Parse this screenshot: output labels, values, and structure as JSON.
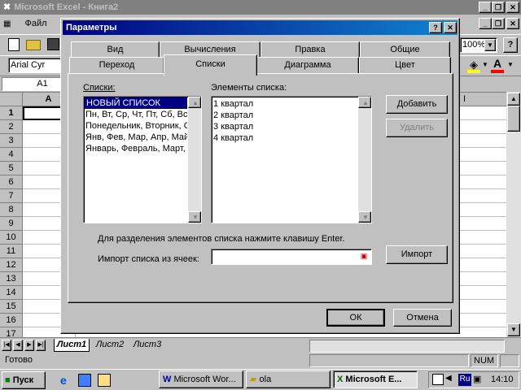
{
  "excel": {
    "title": "Microsoft Excel - Книга2",
    "menu": [
      "Файл"
    ],
    "zoom": "100%",
    "font_name": "Arial Cyr",
    "cell_ref": "A1",
    "column_a": "A",
    "column_i": "I",
    "rows": [
      "1",
      "2",
      "3",
      "4",
      "5",
      "6",
      "7",
      "8",
      "9",
      "10",
      "11",
      "12",
      "13",
      "14",
      "15",
      "16",
      "17"
    ],
    "sheets": [
      "Лист1",
      "Лист2",
      "Лист3"
    ],
    "status": "Готово",
    "num": "NUM"
  },
  "dialog": {
    "title": "Параметры",
    "help_btn": "?",
    "close_btn": "✕",
    "tabs_back": [
      "Вид",
      "Вычисления",
      "Правка",
      "Общие"
    ],
    "tabs_front": [
      "Переход",
      "Списки",
      "Диаграмма",
      "Цвет"
    ],
    "lists_label": "Списки:",
    "lists": [
      "НОВЫЙ СПИСОК",
      "Пн, Вт, Ср, Чт, Пт, Сб, Вс",
      "Понедельник, Вторник, Среда",
      "Янв, Фев, Мар, Апр, Май, Июн",
      "Январь, Февраль, Март, Апрель"
    ],
    "entries_label": "Элементы списка:",
    "entries": [
      "1 квартал",
      "2 квартал",
      "3 квартал",
      "4 квартал"
    ],
    "add_btn": "Добавить",
    "delete_btn": "Удалить",
    "hint": "Для разделения элементов списка нажмите клавишу Enter.",
    "import_label": "Импорт списка из ячеек:",
    "import_value": "",
    "import_btn": "Импорт",
    "ok_btn": "ОК",
    "cancel_btn": "Отмена"
  },
  "taskbar": {
    "start": "Пуск",
    "tasks": [
      "Microsoft Wor...",
      "ola",
      "Microsoft E..."
    ],
    "lang": "Ru",
    "time": "14:10"
  },
  "colors": {
    "titlebar": "#000080",
    "face": "#c0c0c0",
    "desktop": "#008080"
  }
}
